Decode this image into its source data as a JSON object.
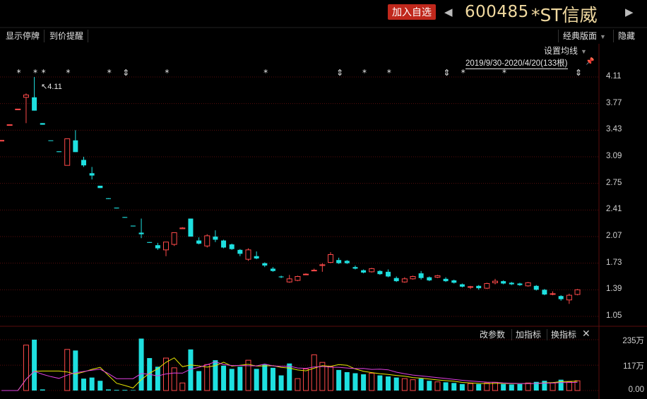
{
  "header": {
    "add_watchlist": "加入自选",
    "prev_icon": "◀",
    "next_icon": "▶",
    "stock_code": "600485",
    "stock_name": "*ST信威"
  },
  "toolbar": {
    "show_suspension": "显示停牌",
    "price_alert": "到价提醒",
    "classic_layout": "经典版面",
    "hide": "隐藏"
  },
  "main_chart": {
    "ma_settings": "设置均线",
    "range_label": "2019/9/30-2020/4/20(133根)",
    "max_marker": "4.11",
    "y_ticks": [
      "4.11",
      "3.77",
      "3.43",
      "3.09",
      "2.75",
      "2.41",
      "2.07",
      "1.73",
      "1.39",
      "1.05"
    ]
  },
  "indicator_panel": {
    "change_params": "改参数",
    "add_indicator": "加指标",
    "switch_indicator": "换指标",
    "y_ticks": [
      "235万",
      "117万",
      "0.00"
    ]
  },
  "colors": {
    "up": "#ff4a4a",
    "down": "#1ee0e0",
    "grid": "#5a0d0d",
    "ma_white": "#ffffff",
    "ma_yellow": "#e6e600",
    "ma_magenta": "#e040e0"
  },
  "chart_data": {
    "type": "candlestick",
    "y_range": [
      1.05,
      4.11
    ],
    "candles": [
      {
        "o": 3.3,
        "c": 3.3,
        "h": 3.3,
        "l": 3.3,
        "dir": "up"
      },
      {
        "o": 3.5,
        "c": 3.5,
        "h": 3.5,
        "l": 3.5,
        "dir": "up"
      },
      {
        "o": 3.7,
        "c": 3.7,
        "h": 3.7,
        "l": 3.7,
        "dir": "up"
      },
      {
        "o": 3.85,
        "c": 3.88,
        "h": 3.9,
        "l": 3.52,
        "dir": "up"
      },
      {
        "o": 3.85,
        "c": 3.68,
        "h": 4.11,
        "l": 3.68,
        "dir": "down"
      },
      {
        "o": 3.52,
        "c": 3.5,
        "h": 3.52,
        "l": 3.5,
        "dir": "down"
      },
      {
        "o": 3.3,
        "c": 3.3,
        "h": 3.3,
        "l": 3.3,
        "dir": "down"
      },
      {
        "o": 3.16,
        "c": 3.15,
        "h": 3.16,
        "l": 3.15,
        "dir": "down"
      },
      {
        "o": 2.98,
        "c": 3.32,
        "h": 3.32,
        "l": 2.98,
        "dir": "up"
      },
      {
        "o": 3.3,
        "c": 3.15,
        "h": 3.43,
        "l": 3.15,
        "dir": "down"
      },
      {
        "o": 3.05,
        "c": 2.98,
        "h": 3.09,
        "l": 2.96,
        "dir": "down"
      },
      {
        "o": 2.88,
        "c": 2.85,
        "h": 2.96,
        "l": 2.8,
        "dir": "down"
      },
      {
        "o": 2.72,
        "c": 2.69,
        "h": 2.72,
        "l": 2.69,
        "dir": "down"
      },
      {
        "o": 2.56,
        "c": 2.55,
        "h": 2.56,
        "l": 2.55,
        "dir": "down"
      },
      {
        "o": 2.44,
        "c": 2.43,
        "h": 2.44,
        "l": 2.43,
        "dir": "down"
      },
      {
        "o": 2.32,
        "c": 2.31,
        "h": 2.32,
        "l": 2.31,
        "dir": "down"
      },
      {
        "o": 2.21,
        "c": 2.2,
        "h": 2.21,
        "l": 2.2,
        "dir": "down"
      },
      {
        "o": 2.12,
        "c": 2.1,
        "h": 2.3,
        "l": 2.05,
        "dir": "down"
      },
      {
        "o": 2.0,
        "c": 1.99,
        "h": 2.0,
        "l": 1.99,
        "dir": "down"
      },
      {
        "o": 1.96,
        "c": 1.92,
        "h": 1.99,
        "l": 1.9,
        "dir": "down"
      },
      {
        "o": 1.9,
        "c": 2.0,
        "h": 2.0,
        "l": 1.82,
        "dir": "up"
      },
      {
        "o": 1.97,
        "c": 2.12,
        "h": 2.12,
        "l": 1.95,
        "dir": "up"
      },
      {
        "o": 2.17,
        "c": 2.18,
        "h": 2.19,
        "l": 2.17,
        "dir": "up"
      },
      {
        "o": 2.3,
        "c": 2.07,
        "h": 2.3,
        "l": 2.07,
        "dir": "down"
      },
      {
        "o": 2.02,
        "c": 1.98,
        "h": 2.06,
        "l": 1.97,
        "dir": "down"
      },
      {
        "o": 1.95,
        "c": 2.08,
        "h": 2.1,
        "l": 1.93,
        "dir": "up"
      },
      {
        "o": 2.07,
        "c": 2.03,
        "h": 2.15,
        "l": 2.0,
        "dir": "down"
      },
      {
        "o": 2.02,
        "c": 1.93,
        "h": 2.03,
        "l": 1.92,
        "dir": "down"
      },
      {
        "o": 1.97,
        "c": 1.91,
        "h": 1.98,
        "l": 1.9,
        "dir": "down"
      },
      {
        "o": 1.9,
        "c": 1.85,
        "h": 1.91,
        "l": 1.82,
        "dir": "down"
      },
      {
        "o": 1.78,
        "c": 1.9,
        "h": 1.92,
        "l": 1.76,
        "dir": "up"
      },
      {
        "o": 1.82,
        "c": 1.79,
        "h": 1.88,
        "l": 1.78,
        "dir": "down"
      },
      {
        "o": 1.73,
        "c": 1.7,
        "h": 1.74,
        "l": 1.68,
        "dir": "down"
      },
      {
        "o": 1.66,
        "c": 1.63,
        "h": 1.68,
        "l": 1.62,
        "dir": "down"
      },
      {
        "o": 1.56,
        "c": 1.55,
        "h": 1.57,
        "l": 1.54,
        "dir": "down"
      },
      {
        "o": 1.49,
        "c": 1.53,
        "h": 1.58,
        "l": 1.48,
        "dir": "up"
      },
      {
        "o": 1.51,
        "c": 1.56,
        "h": 1.57,
        "l": 1.5,
        "dir": "up"
      },
      {
        "o": 1.59,
        "c": 1.59,
        "h": 1.6,
        "l": 1.58,
        "dir": "up"
      },
      {
        "o": 1.64,
        "c": 1.64,
        "h": 1.66,
        "l": 1.63,
        "dir": "up"
      },
      {
        "o": 1.7,
        "c": 1.71,
        "h": 1.73,
        "l": 1.62,
        "dir": "up"
      },
      {
        "o": 1.74,
        "c": 1.84,
        "h": 1.87,
        "l": 1.73,
        "dir": "up"
      },
      {
        "o": 1.77,
        "c": 1.73,
        "h": 1.8,
        "l": 1.72,
        "dir": "down"
      },
      {
        "o": 1.76,
        "c": 1.73,
        "h": 1.77,
        "l": 1.72,
        "dir": "down"
      },
      {
        "o": 1.68,
        "c": 1.66,
        "h": 1.7,
        "l": 1.65,
        "dir": "down"
      },
      {
        "o": 1.64,
        "c": 1.61,
        "h": 1.65,
        "l": 1.6,
        "dir": "down"
      },
      {
        "o": 1.62,
        "c": 1.66,
        "h": 1.67,
        "l": 1.61,
        "dir": "up"
      },
      {
        "o": 1.63,
        "c": 1.59,
        "h": 1.64,
        "l": 1.58,
        "dir": "down"
      },
      {
        "o": 1.62,
        "c": 1.56,
        "h": 1.65,
        "l": 1.55,
        "dir": "down"
      },
      {
        "o": 1.54,
        "c": 1.5,
        "h": 1.56,
        "l": 1.49,
        "dir": "down"
      },
      {
        "o": 1.49,
        "c": 1.53,
        "h": 1.55,
        "l": 1.48,
        "dir": "up"
      },
      {
        "o": 1.53,
        "c": 1.56,
        "h": 1.57,
        "l": 1.52,
        "dir": "up"
      },
      {
        "o": 1.6,
        "c": 1.54,
        "h": 1.63,
        "l": 1.52,
        "dir": "down"
      },
      {
        "o": 1.55,
        "c": 1.51,
        "h": 1.56,
        "l": 1.5,
        "dir": "down"
      },
      {
        "o": 1.55,
        "c": 1.57,
        "h": 1.58,
        "l": 1.54,
        "dir": "up"
      },
      {
        "o": 1.53,
        "c": 1.5,
        "h": 1.55,
        "l": 1.49,
        "dir": "down"
      },
      {
        "o": 1.51,
        "c": 1.48,
        "h": 1.52,
        "l": 1.47,
        "dir": "down"
      },
      {
        "o": 1.46,
        "c": 1.43,
        "h": 1.47,
        "l": 1.42,
        "dir": "down"
      },
      {
        "o": 1.43,
        "c": 1.43,
        "h": 1.44,
        "l": 1.4,
        "dir": "up"
      },
      {
        "o": 1.44,
        "c": 1.41,
        "h": 1.45,
        "l": 1.39,
        "dir": "down"
      },
      {
        "o": 1.41,
        "c": 1.47,
        "h": 1.48,
        "l": 1.4,
        "dir": "up"
      },
      {
        "o": 1.48,
        "c": 1.5,
        "h": 1.53,
        "l": 1.46,
        "dir": "up"
      },
      {
        "o": 1.5,
        "c": 1.47,
        "h": 1.51,
        "l": 1.46,
        "dir": "down"
      },
      {
        "o": 1.48,
        "c": 1.46,
        "h": 1.49,
        "l": 1.45,
        "dir": "down"
      },
      {
        "o": 1.47,
        "c": 1.45,
        "h": 1.48,
        "l": 1.44,
        "dir": "down"
      },
      {
        "o": 1.44,
        "c": 1.48,
        "h": 1.49,
        "l": 1.43,
        "dir": "up"
      },
      {
        "o": 1.44,
        "c": 1.39,
        "h": 1.45,
        "l": 1.38,
        "dir": "down"
      },
      {
        "o": 1.39,
        "c": 1.33,
        "h": 1.4,
        "l": 1.32,
        "dir": "down"
      },
      {
        "o": 1.34,
        "c": 1.34,
        "h": 1.37,
        "l": 1.32,
        "dir": "up"
      },
      {
        "o": 1.31,
        "c": 1.27,
        "h": 1.32,
        "l": 1.25,
        "dir": "down"
      },
      {
        "o": 1.26,
        "c": 1.32,
        "h": 1.34,
        "l": 1.21,
        "dir": "up"
      },
      {
        "o": 1.33,
        "c": 1.39,
        "h": 1.4,
        "l": 1.32,
        "dir": "up"
      }
    ],
    "volume_y_range": [
      0,
      235
    ],
    "volume_unit": "万",
    "volumes": [
      {
        "v": 0,
        "dir": "up"
      },
      {
        "v": 0,
        "dir": "up"
      },
      {
        "v": 0,
        "dir": "up"
      },
      {
        "v": 210,
        "dir": "up"
      },
      {
        "v": 235,
        "dir": "down"
      },
      {
        "v": 5,
        "dir": "down"
      },
      {
        "v": 0,
        "dir": "down"
      },
      {
        "v": 0,
        "dir": "down"
      },
      {
        "v": 190,
        "dir": "up"
      },
      {
        "v": 185,
        "dir": "down"
      },
      {
        "v": 55,
        "dir": "down"
      },
      {
        "v": 60,
        "dir": "down"
      },
      {
        "v": 45,
        "dir": "down"
      },
      {
        "v": 5,
        "dir": "down"
      },
      {
        "v": 3,
        "dir": "down"
      },
      {
        "v": 3,
        "dir": "down"
      },
      {
        "v": 2,
        "dir": "down"
      },
      {
        "v": 240,
        "dir": "down"
      },
      {
        "v": 150,
        "dir": "down"
      },
      {
        "v": 110,
        "dir": "down"
      },
      {
        "v": 150,
        "dir": "up"
      },
      {
        "v": 105,
        "dir": "up"
      },
      {
        "v": 35,
        "dir": "up"
      },
      {
        "v": 190,
        "dir": "down"
      },
      {
        "v": 90,
        "dir": "down"
      },
      {
        "v": 120,
        "dir": "up"
      },
      {
        "v": 140,
        "dir": "down"
      },
      {
        "v": 115,
        "dir": "down"
      },
      {
        "v": 100,
        "dir": "down"
      },
      {
        "v": 110,
        "dir": "down"
      },
      {
        "v": 140,
        "dir": "up"
      },
      {
        "v": 100,
        "dir": "down"
      },
      {
        "v": 120,
        "dir": "down"
      },
      {
        "v": 105,
        "dir": "down"
      },
      {
        "v": 70,
        "dir": "down"
      },
      {
        "v": 125,
        "dir": "down"
      },
      {
        "v": 55,
        "dir": "up"
      },
      {
        "v": 100,
        "dir": "up"
      },
      {
        "v": 165,
        "dir": "up"
      },
      {
        "v": 130,
        "dir": "up"
      },
      {
        "v": 110,
        "dir": "up"
      },
      {
        "v": 95,
        "dir": "down"
      },
      {
        "v": 85,
        "dir": "down"
      },
      {
        "v": 80,
        "dir": "down"
      },
      {
        "v": 75,
        "dir": "down"
      },
      {
        "v": 80,
        "dir": "up"
      },
      {
        "v": 70,
        "dir": "down"
      },
      {
        "v": 65,
        "dir": "down"
      },
      {
        "v": 60,
        "dir": "down"
      },
      {
        "v": 55,
        "dir": "up"
      },
      {
        "v": 50,
        "dir": "up"
      },
      {
        "v": 55,
        "dir": "down"
      },
      {
        "v": 45,
        "dir": "down"
      },
      {
        "v": 40,
        "dir": "up"
      },
      {
        "v": 38,
        "dir": "down"
      },
      {
        "v": 35,
        "dir": "down"
      },
      {
        "v": 30,
        "dir": "down"
      },
      {
        "v": 32,
        "dir": "up"
      },
      {
        "v": 30,
        "dir": "down"
      },
      {
        "v": 35,
        "dir": "up"
      },
      {
        "v": 38,
        "dir": "up"
      },
      {
        "v": 30,
        "dir": "down"
      },
      {
        "v": 28,
        "dir": "down"
      },
      {
        "v": 30,
        "dir": "down"
      },
      {
        "v": 35,
        "dir": "up"
      },
      {
        "v": 40,
        "dir": "down"
      },
      {
        "v": 45,
        "dir": "down"
      },
      {
        "v": 35,
        "dir": "up"
      },
      {
        "v": 50,
        "dir": "down"
      },
      {
        "v": 40,
        "dir": "up"
      },
      {
        "v": 45,
        "dir": "up"
      }
    ],
    "event_markers": [
      {
        "index": 1,
        "symbol": "*"
      },
      {
        "index": 3,
        "symbol": "*"
      },
      {
        "index": 4,
        "symbol": "*"
      },
      {
        "index": 7,
        "symbol": "*"
      },
      {
        "index": 12,
        "symbol": "*"
      },
      {
        "index": 14,
        "symbol": "⇕"
      },
      {
        "index": 19,
        "symbol": "*"
      },
      {
        "index": 31,
        "symbol": "*"
      },
      {
        "index": 40,
        "symbol": "⇕"
      },
      {
        "index": 43,
        "symbol": "*"
      },
      {
        "index": 46,
        "symbol": "*"
      },
      {
        "index": 53,
        "symbol": "⇕"
      },
      {
        "index": 55,
        "symbol": "*"
      },
      {
        "index": 60,
        "symbol": "*"
      },
      {
        "index": 69,
        "symbol": "⇕"
      }
    ]
  }
}
